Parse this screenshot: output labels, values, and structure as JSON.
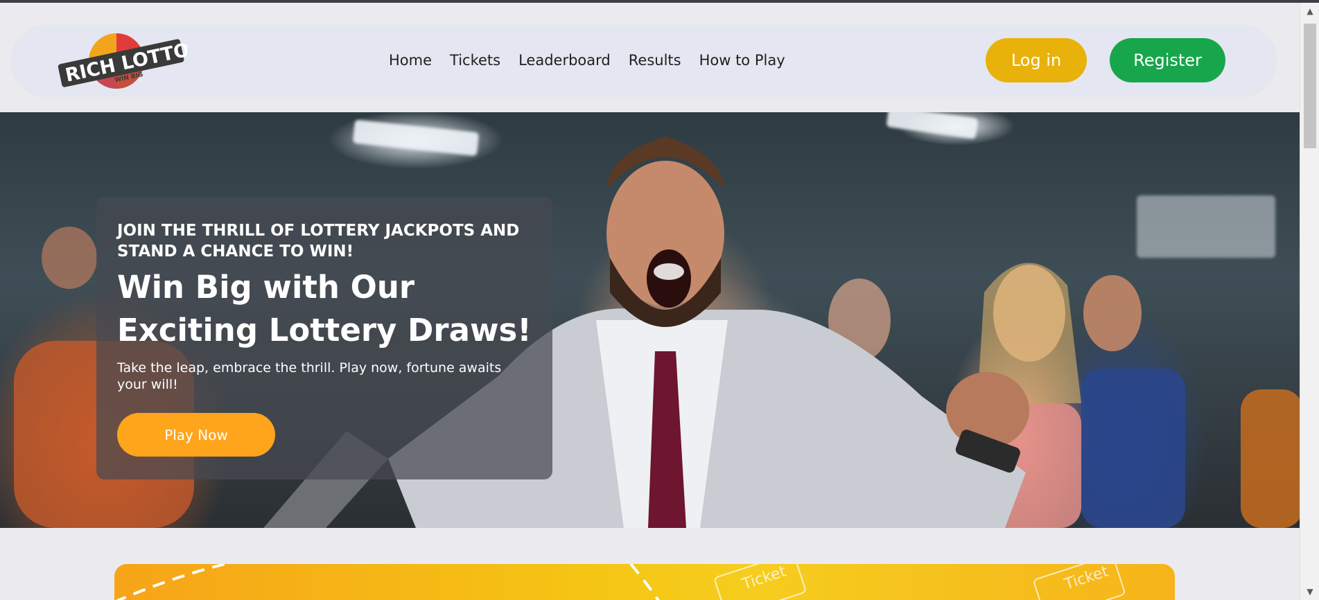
{
  "brand": {
    "logo_text_top": "RICH LOTTO",
    "logo_text_bottom": "WIN BIG"
  },
  "nav": {
    "links": [
      {
        "label": "Home"
      },
      {
        "label": "Tickets"
      },
      {
        "label": "Leaderboard"
      },
      {
        "label": "Results"
      },
      {
        "label": "How to Play"
      }
    ],
    "login_label": "Log in",
    "register_label": "Register"
  },
  "hero": {
    "eyebrow": "JOIN THE THRILL OF LOTTERY JACKPOTS AND STAND A CHANCE TO WIN!",
    "title": "Win Big with Our Exciting Lottery Draws!",
    "subtitle": "Take the leap, embrace the thrill. Play now, fortune awaits your will!",
    "cta_label": "Play Now"
  },
  "promo": {
    "ticket_label": "Ticket"
  },
  "colors": {
    "login": "#e8b20b",
    "register": "#18a64c",
    "play_now": "#ffa51c",
    "navbar_bg": "#e4e7f1"
  }
}
